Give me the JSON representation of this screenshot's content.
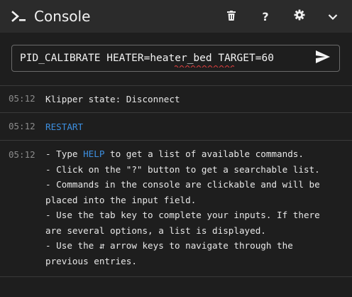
{
  "header": {
    "title": "Console",
    "icons": [
      "console-prompt-icon",
      "trash-icon",
      "help-icon",
      "gear-icon",
      "chevron-down-icon"
    ],
    "help_label": "?"
  },
  "command_input": {
    "value": "PID_CALIBRATE HEATER=heater_bed TARGET=60",
    "send_icon": "send-icon"
  },
  "entries": [
    {
      "time": "05:12",
      "text": "Klipper state: Disconnect"
    },
    {
      "time": "05:12",
      "text": "RESTART"
    },
    {
      "time": "05:12",
      "lines": {
        "l1_pre": "- Type ",
        "l1_link": "HELP",
        "l1_post": " to get a list of available commands.",
        "l2": "- Click on the \"?\" button to get a searchable list.",
        "l3": "- Commands in the console are clickable and will be",
        "l4": "placed into the input field.",
        "l5": "- Use the tab key to complete your inputs. If there",
        "l6": "are several options, a list is displayed.",
        "l7": "- Use the ⇵ arrow keys to navigate through the",
        "l8": "previous entries."
      }
    }
  ],
  "colors": {
    "background": "#1e1e1e",
    "header": "#2b2b2b",
    "link": "#3d8fe0",
    "timestamp": "#8b8b8b"
  }
}
